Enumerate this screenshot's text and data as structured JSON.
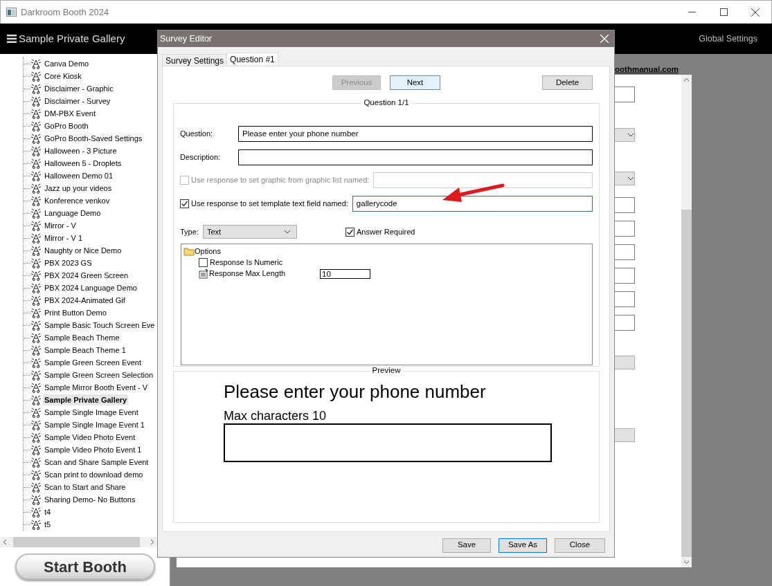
{
  "window": {
    "title": "Darkroom Booth 2024"
  },
  "header": {
    "title": "Sample Private Gallery",
    "right_link": "Global Settings"
  },
  "sidebar": {
    "items": [
      {
        "label": "Canva Demo",
        "selected": false
      },
      {
        "label": "Core Kiosk",
        "selected": false
      },
      {
        "label": "Disclaimer - Graphic",
        "selected": false
      },
      {
        "label": "Disclaimer - Survey",
        "selected": false
      },
      {
        "label": "DM-PBX Event",
        "selected": false
      },
      {
        "label": "GoPro Booth",
        "selected": false
      },
      {
        "label": "GoPro Booth-Saved Settings",
        "selected": false
      },
      {
        "label": "Halloween - 3  Picture",
        "selected": false
      },
      {
        "label": "Halloween 5 - Droplets",
        "selected": false
      },
      {
        "label": "Halloween Demo 01",
        "selected": false
      },
      {
        "label": "Jazz up your videos",
        "selected": false
      },
      {
        "label": "Konference venkov",
        "selected": false
      },
      {
        "label": "Language Demo",
        "selected": false
      },
      {
        "label": "Mirror - V",
        "selected": false
      },
      {
        "label": "Mirror - V  1",
        "selected": false
      },
      {
        "label": "Naughty or Nice Demo",
        "selected": false
      },
      {
        "label": "PBX 2023 GS",
        "selected": false
      },
      {
        "label": "PBX 2024 Green Screen",
        "selected": false
      },
      {
        "label": "PBX 2024 Language Demo",
        "selected": false
      },
      {
        "label": "PBX 2024-Animated Gif",
        "selected": false
      },
      {
        "label": "Print Button Demo",
        "selected": false
      },
      {
        "label": "Sample Basic Touch Screen Eve",
        "selected": false
      },
      {
        "label": "Sample Beach Theme",
        "selected": false
      },
      {
        "label": "Sample Beach Theme  1",
        "selected": false
      },
      {
        "label": "Sample Green Screen Event",
        "selected": false
      },
      {
        "label": "Sample Green Screen Selection",
        "selected": false
      },
      {
        "label": "Sample Mirror Booth Event - V",
        "selected": false
      },
      {
        "label": "Sample Private Gallery",
        "selected": true
      },
      {
        "label": "Sample Single Image Event",
        "selected": false
      },
      {
        "label": "Sample Single Image Event  1",
        "selected": false
      },
      {
        "label": "Sample Video Photo Event",
        "selected": false
      },
      {
        "label": "Sample Video Photo Event  1",
        "selected": false
      },
      {
        "label": "Scan and Share Sample Event",
        "selected": false
      },
      {
        "label": "Scan print to download demo",
        "selected": false
      },
      {
        "label": "Scan to Start and Share",
        "selected": false
      },
      {
        "label": "Sharing Demo- No Buttons",
        "selected": false
      },
      {
        "label": "t4",
        "selected": false
      },
      {
        "label": "t5",
        "selected": false
      }
    ],
    "start_button": "Start Booth"
  },
  "main": {
    "link": "oothmanual.com",
    "fields": [
      {
        "kind": "input"
      },
      {
        "kind": "select"
      },
      {
        "kind": "select"
      },
      {
        "kind": "input"
      },
      {
        "kind": "input"
      },
      {
        "kind": "input"
      },
      {
        "kind": "input"
      },
      {
        "kind": "input"
      },
      {
        "kind": "input"
      },
      {
        "kind": "button"
      },
      {
        "kind": "button"
      }
    ]
  },
  "dialog": {
    "title": "Survey Editor",
    "tabs": [
      {
        "label": "Survey Settings",
        "selected": false
      },
      {
        "label": "Question #1",
        "selected": true
      }
    ],
    "nav_buttons": [
      {
        "label": "Previous",
        "disabled": true,
        "focused": false
      },
      {
        "label": "Next",
        "disabled": false,
        "focused": true
      }
    ],
    "delete_button": "Delete",
    "question_group": {
      "title": "Question 1/1",
      "question": {
        "label": "Question:",
        "value": "Please enter your phone number"
      },
      "description": {
        "label": "Description:"
      },
      "graphic_option": {
        "label": "Use response to set graphic from graphic list named:",
        "checked": false,
        "disabled": true
      },
      "template_option": {
        "label": "Use response to set template text field named:",
        "checked": true,
        "disabled": false,
        "value": "gallerycode",
        "focused": true
      },
      "type": {
        "label": "Type:",
        "value": "Text"
      },
      "answer_required": {
        "label": "Answer Required",
        "checked": true
      },
      "options": {
        "label": "Options",
        "children": [
          {
            "kind": "checkbox",
            "label": "Response Is Numeric",
            "checked": false
          },
          {
            "kind": "number",
            "label": "Response Max Length",
            "value": "10"
          }
        ]
      }
    },
    "preview": {
      "title": "Preview",
      "question": "Please enter your phone number",
      "hint": "Max characters 10"
    },
    "footer_buttons": [
      {
        "label": "Save",
        "default": false
      },
      {
        "label": "Save As",
        "default": true
      },
      {
        "label": "Close",
        "default": false
      }
    ]
  }
}
